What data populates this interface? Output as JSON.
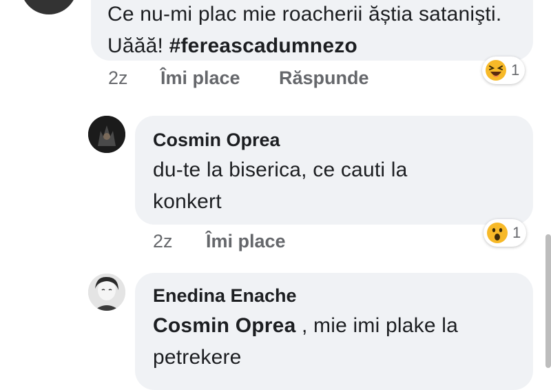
{
  "comments": [
    {
      "text": "Ce nu-mi plac mie roacherii ăștia satanişti. Uăăă!",
      "hashtag": "#fereascadumnezo",
      "time": "2z",
      "like": "Îmi place",
      "reply": "Răspunde",
      "reaction": {
        "icon": "laugh-emoji-icon",
        "count": "1"
      }
    },
    {
      "author": "Cosmin Oprea",
      "text": "du-te la biserica, ce cauti la konkert",
      "time": "2z",
      "like": "Îmi place",
      "reaction": {
        "icon": "wow-emoji-icon",
        "count": "1"
      }
    },
    {
      "author": "Enedina Enache",
      "mention": "Cosmin Oprea",
      "text": " , mie imi plake la petrekere"
    }
  ],
  "colors": {
    "bubble": "#f0f2f5",
    "meta": "#65676b",
    "text": "#1c1e21",
    "emoji": "#f7b928"
  }
}
